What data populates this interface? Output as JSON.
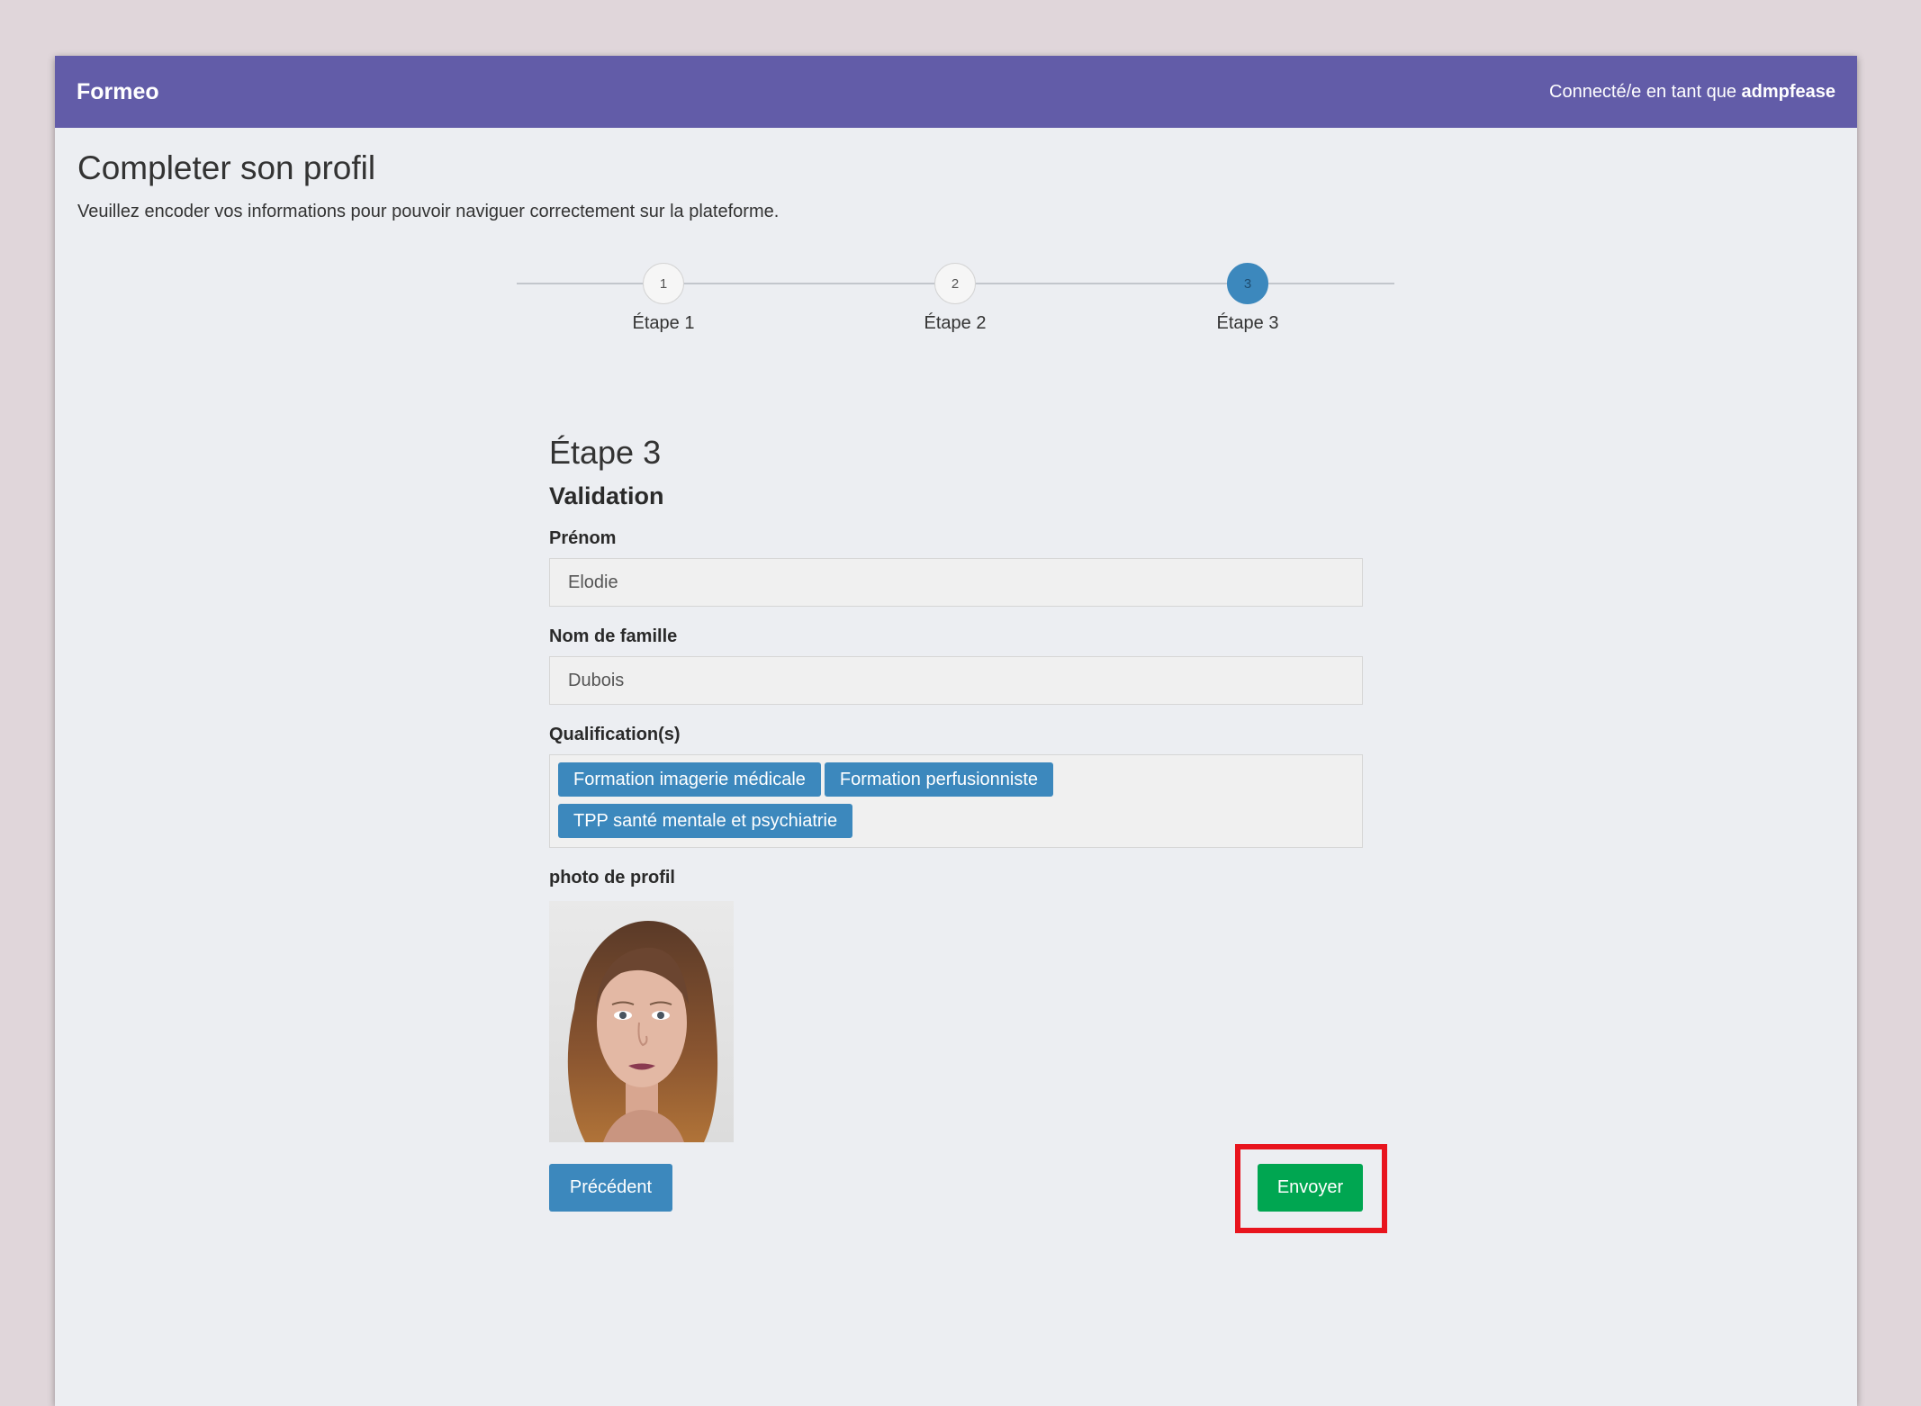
{
  "navbar": {
    "brand": "Formeo",
    "user_prefix": "Connecté/e en tant que ",
    "username": "admpfease"
  },
  "page": {
    "title": "Completer son profil",
    "subtitle": "Veuillez encoder vos informations pour pouvoir naviguer correctement sur la plateforme."
  },
  "stepper": {
    "steps": [
      {
        "number": "1",
        "label": "Étape 1"
      },
      {
        "number": "2",
        "label": "Étape 2"
      },
      {
        "number": "3",
        "label": "Étape 3"
      }
    ],
    "active_step": 3
  },
  "form": {
    "step_title": "Étape 3",
    "section_title": "Validation",
    "first_name_label": "Prénom",
    "first_name_value": "Elodie",
    "last_name_label": "Nom de famille",
    "last_name_value": "Dubois",
    "qualifications_label": "Qualification(s)",
    "qualifications": [
      "Formation imagerie médicale",
      "Formation perfusionniste",
      "TPP santé mentale et psychiatrie"
    ],
    "photo_label": "photo de profil",
    "prev_button": "Précédent",
    "send_button": "Envoyer"
  },
  "colors": {
    "navbar": "#625ca8",
    "primary": "#3c88bd",
    "success": "#00a651",
    "highlight": "#e8141e"
  }
}
